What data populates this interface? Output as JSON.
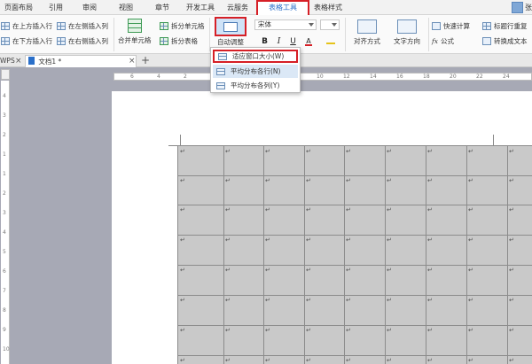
{
  "ribbon_tabs": [
    {
      "label": "页面布局"
    },
    {
      "label": "引用"
    },
    {
      "label": "审阅"
    },
    {
      "label": "视图"
    },
    {
      "label": "章节"
    },
    {
      "label": "开发工具"
    },
    {
      "label": "云服务"
    },
    {
      "label": "表格工具"
    },
    {
      "label": "表格样式"
    }
  ],
  "active_tab": "表格工具",
  "user": {
    "name": "张"
  },
  "ribbon": {
    "insert_above": "在上方插入行",
    "insert_left": "在左侧插入列",
    "insert_below": "在下方插入行",
    "insert_right": "在右侧插入列",
    "merge_cells": "合并单元格",
    "split_cells": "拆分单元格",
    "split_table": "拆分表格",
    "autofit": "自动调整",
    "font_name": "宋体",
    "bold": "B",
    "italic": "I",
    "underline": "U",
    "align": "对齐方式",
    "text_direction": "文字方向",
    "quick_calc": "快速计算",
    "formula": "公式",
    "repeat_header": "标题行重复",
    "convert_text": "转换成文本"
  },
  "doc_tabs": {
    "wps": "WPS",
    "doc_name": "文档1 *",
    "close_glyph": "×",
    "new_tab_glyph": "+"
  },
  "autofit_menu": [
    {
      "label": "适应窗口大小(W)"
    },
    {
      "label": "平均分布各行(N)"
    },
    {
      "label": "平均分布各列(Y)"
    }
  ],
  "ruler": {
    "h_numbers": [
      "6",
      "4",
      "2",
      "2",
      "4",
      "6",
      "8",
      "10",
      "12",
      "14",
      "16",
      "18",
      "20",
      "22",
      "24"
    ],
    "v_numbers": [
      "4",
      "3",
      "2",
      "1",
      "1",
      "2",
      "3",
      "4",
      "5",
      "6",
      "7",
      "8",
      "9",
      "10"
    ]
  },
  "table": {
    "paragraph_mark": "↵"
  },
  "colors": {
    "accent_blue": "#2a6fc9",
    "highlight_red": "#d61f26",
    "table_fill": "#c9c9c9",
    "canvas": "#a7a9b5"
  }
}
